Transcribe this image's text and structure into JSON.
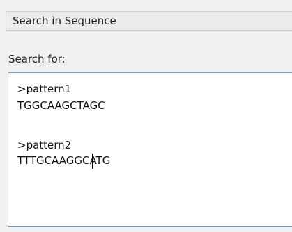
{
  "panel": {
    "group_title": "Search in Sequence",
    "search_label": "Search for:",
    "textarea": {
      "lines": [
        ">pattern1",
        "TGGCAAGCTAGC",
        "",
        ">pattern2",
        "TTTGCAAGGCATG"
      ]
    }
  }
}
